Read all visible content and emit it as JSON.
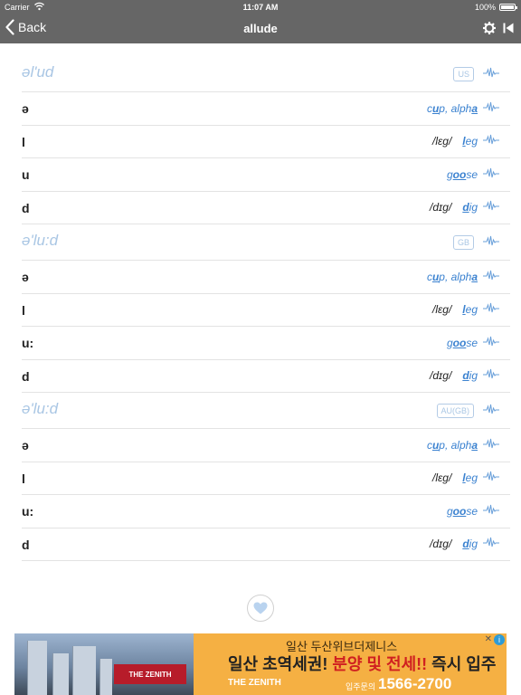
{
  "status": {
    "carrier": "Carrier",
    "time": "11:07 AM",
    "battery": "100%"
  },
  "nav": {
    "back_label": "Back",
    "title": "allude"
  },
  "sections": [
    {
      "ipa": "əl'ud",
      "region": "US",
      "phonemes": [
        {
          "symbol": "ə",
          "slash": "",
          "example_pre": "c",
          "example_bold": "u",
          "example_post": "p, alph",
          "example_bold2": "a",
          "example_post2": ""
        },
        {
          "symbol": "l",
          "slash": "/lɛg/",
          "example_pre": "",
          "example_bold": "l",
          "example_post": "eg",
          "example_bold2": "",
          "example_post2": ""
        },
        {
          "symbol": "u",
          "slash": "",
          "example_pre": "g",
          "example_bold": "oo",
          "example_post": "se",
          "example_bold2": "",
          "example_post2": ""
        },
        {
          "symbol": "d",
          "slash": "/dɪg/",
          "example_pre": "",
          "example_bold": "d",
          "example_post": "ig",
          "example_bold2": "",
          "example_post2": ""
        }
      ]
    },
    {
      "ipa": "ə'lu:d",
      "region": "GB",
      "phonemes": [
        {
          "symbol": "ə",
          "slash": "",
          "example_pre": "c",
          "example_bold": "u",
          "example_post": "p, alph",
          "example_bold2": "a",
          "example_post2": ""
        },
        {
          "symbol": "l",
          "slash": "/lɛg/",
          "example_pre": "",
          "example_bold": "l",
          "example_post": "eg",
          "example_bold2": "",
          "example_post2": ""
        },
        {
          "symbol": "u:",
          "slash": "",
          "example_pre": "g",
          "example_bold": "oo",
          "example_post": "se",
          "example_bold2": "",
          "example_post2": ""
        },
        {
          "symbol": "d",
          "slash": "/dɪg/",
          "example_pre": "",
          "example_bold": "d",
          "example_post": "ig",
          "example_bold2": "",
          "example_post2": ""
        }
      ]
    },
    {
      "ipa": "ə'lu:d",
      "region": "AU(GB)",
      "phonemes": [
        {
          "symbol": "ə",
          "slash": "",
          "example_pre": "c",
          "example_bold": "u",
          "example_post": "p, alph",
          "example_bold2": "a",
          "example_post2": ""
        },
        {
          "symbol": "l",
          "slash": "/lɛg/",
          "example_pre": "",
          "example_bold": "l",
          "example_post": "eg",
          "example_bold2": "",
          "example_post2": ""
        },
        {
          "symbol": "u:",
          "slash": "",
          "example_pre": "g",
          "example_bold": "oo",
          "example_post": "se",
          "example_bold2": "",
          "example_post2": ""
        },
        {
          "symbol": "d",
          "slash": "/dɪg/",
          "example_pre": "",
          "example_bold": "d",
          "example_post": "ig",
          "example_bold2": "",
          "example_post2": ""
        }
      ]
    }
  ],
  "ad": {
    "building_sign": "THE ZENITH",
    "line1": "일산 두산위브더제니스",
    "line2_a": "일산 초역세권! ",
    "line2_b": "분양 및 전세!!",
    "line2_c": " 즉시 입주",
    "logo": "THE ZENITH",
    "inquiry": "입주문의",
    "phone": "1566-2700",
    "choices": "i",
    "close": "✕"
  },
  "colors": {
    "bar": "#666666",
    "accent": "#3b82d0",
    "ipa": "#a9c6e4"
  }
}
